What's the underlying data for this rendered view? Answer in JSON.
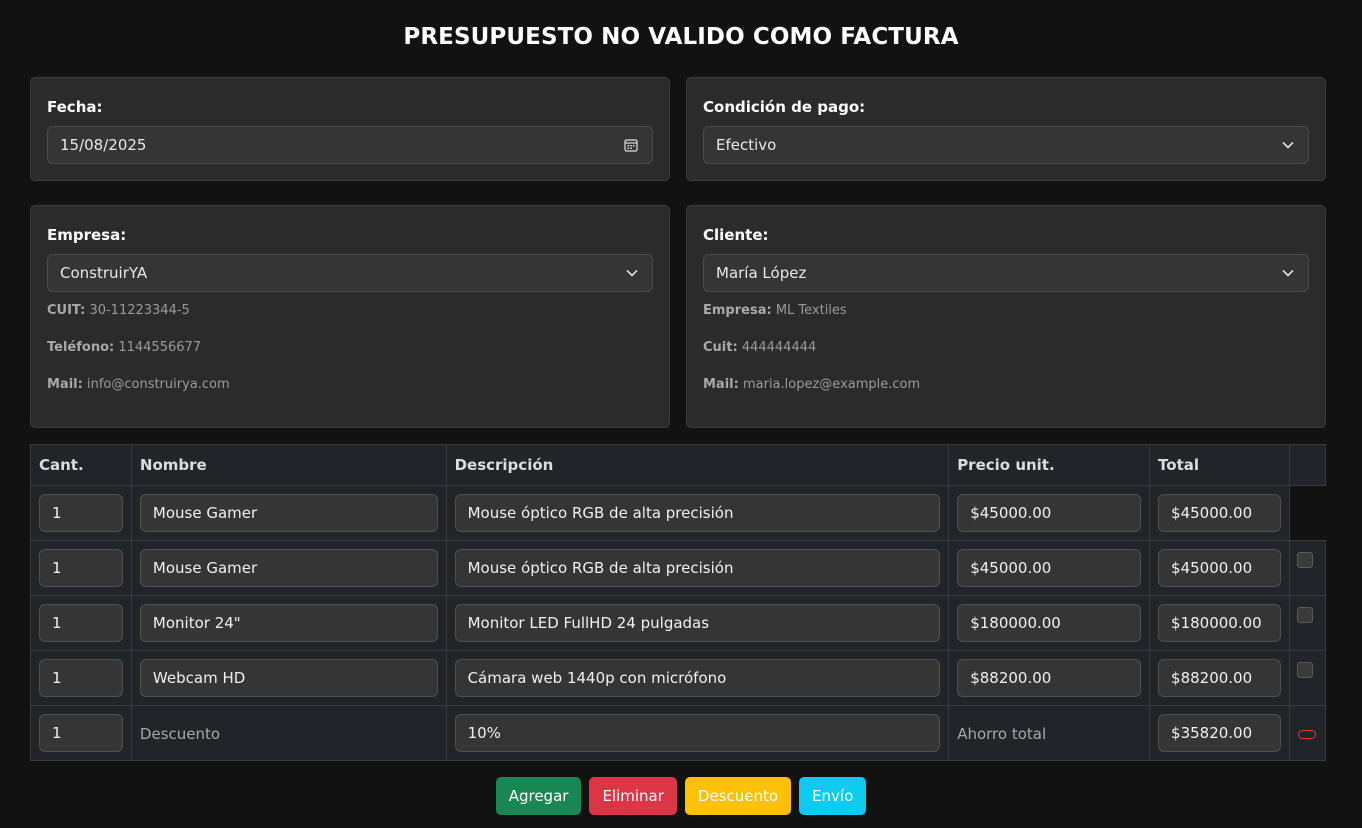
{
  "page_title": "PRESUPUESTO NO VALIDO COMO FACTURA",
  "fecha": {
    "label": "Fecha:",
    "value": "15/08/2025",
    "icon": "calendar-icon"
  },
  "condicion": {
    "label": "Condición de pago:",
    "value": "Efectivo",
    "icon": "chevron-down-icon"
  },
  "empresa": {
    "label": "Empresa:",
    "value": "ConstruirYA",
    "cuit_label": "CUIT:",
    "cuit": "30-11223344-5",
    "telefono_label": "Teléfono:",
    "telefono": "1144556677",
    "mail_label": "Mail:",
    "mail": "info@construirya.com"
  },
  "cliente": {
    "label": "Cliente:",
    "value": "María López",
    "empresa_label": "Empresa:",
    "empresa": "ML Textiles",
    "cuit_label": "Cuit:",
    "cuit": "444444444",
    "mail_label": "Mail:",
    "mail": "maria.lopez@example.com"
  },
  "table": {
    "headers": {
      "cant": "Cant.",
      "nombre": "Nombre",
      "descripcion": "Descripción",
      "precio": "Precio unit.",
      "total": "Total"
    },
    "rows": [
      {
        "cant": "1",
        "nombre": "Mouse Gamer",
        "descripcion": "Mouse óptico RGB de alta precisión",
        "precio": "$45000.00",
        "total": "$45000.00"
      },
      {
        "cant": "1",
        "nombre": "Mouse Gamer",
        "descripcion": "Mouse óptico RGB de alta precisión",
        "precio": "$45000.00",
        "total": "$45000.00"
      },
      {
        "cant": "1",
        "nombre": "Monitor 24\"",
        "descripcion": "Monitor LED FullHD 24 pulgadas",
        "precio": "$180000.00",
        "total": "$180000.00"
      },
      {
        "cant": "1",
        "nombre": "Webcam HD",
        "descripcion": "Cámara web 1440p con micrófono",
        "precio": "$88200.00",
        "total": "$88200.00"
      }
    ],
    "discount_row": {
      "cant": "1",
      "nombre": "Descuento",
      "descripcion": "10%",
      "precio": "Ahorro total",
      "total": "$35820.00"
    }
  },
  "buttons": {
    "agregar": "Agregar",
    "eliminar": "Eliminar",
    "descuento": "Descuento",
    "envio": "Envío"
  },
  "colors": {
    "agregar": "#198754",
    "eliminar": "#dc3545",
    "descuento": "#ffc107",
    "envio": "#0dcaf0"
  }
}
